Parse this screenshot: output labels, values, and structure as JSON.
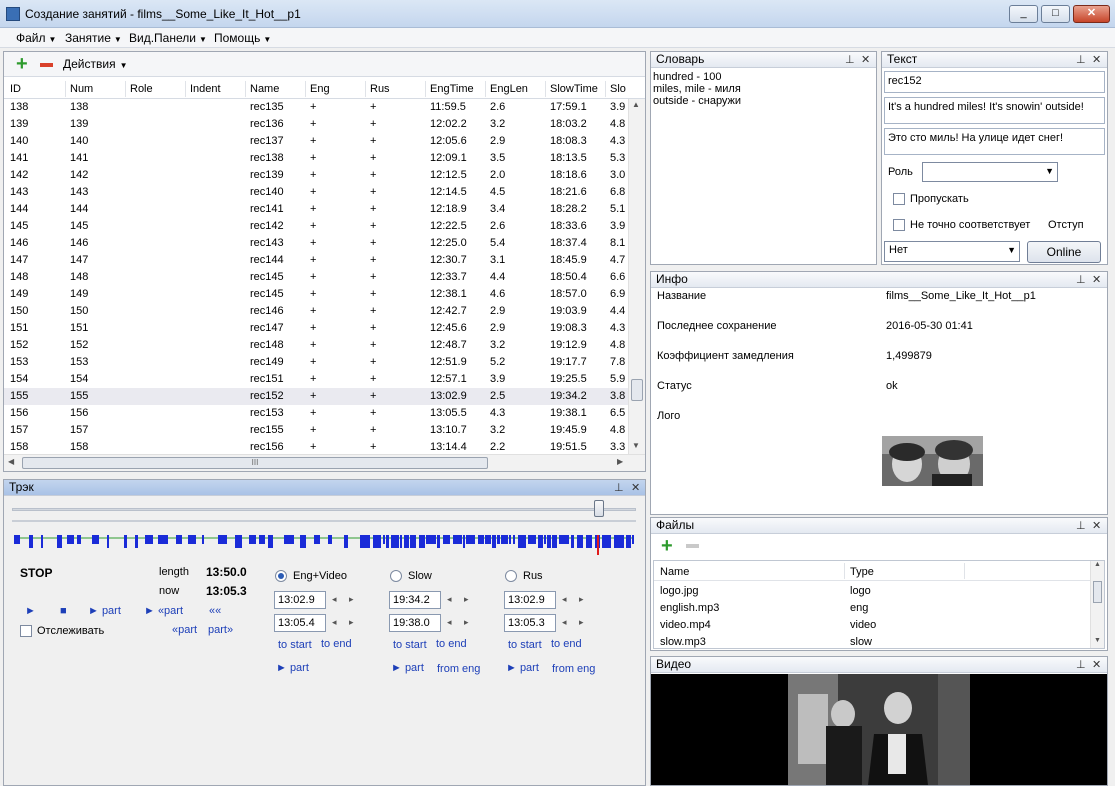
{
  "window": {
    "title": "Создание занятий - films__Some_Like_It_Hot__p1",
    "min": "_",
    "max": "□",
    "close": "✕"
  },
  "menu": [
    "Файл",
    "Занятие",
    "Вид.Панели",
    "Помощь"
  ],
  "grid": {
    "toolbar": {
      "add": "+",
      "actions_label": "Действия"
    },
    "columns": [
      "ID",
      "Num",
      "Role",
      "Indent",
      "Name",
      "Eng",
      "Rus",
      "EngTime",
      "EngLen",
      "SlowTime",
      "Slo"
    ],
    "rows": [
      [
        "138",
        "138",
        "",
        "",
        "rec135",
        "+",
        "+",
        "11:59.5",
        "2.6",
        "17:59.1",
        "3.9"
      ],
      [
        "139",
        "139",
        "",
        "",
        "rec136",
        "+",
        "+",
        "12:02.2",
        "3.2",
        "18:03.2",
        "4.8"
      ],
      [
        "140",
        "140",
        "",
        "",
        "rec137",
        "+",
        "+",
        "12:05.6",
        "2.9",
        "18:08.3",
        "4.3"
      ],
      [
        "141",
        "141",
        "",
        "",
        "rec138",
        "+",
        "+",
        "12:09.1",
        "3.5",
        "18:13.5",
        "5.3"
      ],
      [
        "142",
        "142",
        "",
        "",
        "rec139",
        "+",
        "+",
        "12:12.5",
        "2.0",
        "18:18.6",
        "3.0"
      ],
      [
        "143",
        "143",
        "",
        "",
        "rec140",
        "+",
        "+",
        "12:14.5",
        "4.5",
        "18:21.6",
        "6.8"
      ],
      [
        "144",
        "144",
        "",
        "",
        "rec141",
        "+",
        "+",
        "12:18.9",
        "3.4",
        "18:28.2",
        "5.1"
      ],
      [
        "145",
        "145",
        "",
        "",
        "rec142",
        "+",
        "+",
        "12:22.5",
        "2.6",
        "18:33.6",
        "3.9"
      ],
      [
        "146",
        "146",
        "",
        "",
        "rec143",
        "+",
        "+",
        "12:25.0",
        "5.4",
        "18:37.4",
        "8.1"
      ],
      [
        "147",
        "147",
        "",
        "",
        "rec144",
        "+",
        "+",
        "12:30.7",
        "3.1",
        "18:45.9",
        "4.7"
      ],
      [
        "148",
        "148",
        "",
        "",
        "rec145",
        "+",
        "+",
        "12:33.7",
        "4.4",
        "18:50.4",
        "6.6"
      ],
      [
        "149",
        "149",
        "",
        "",
        "rec145",
        "+",
        "+",
        "12:38.1",
        "4.6",
        "18:57.0",
        "6.9"
      ],
      [
        "150",
        "150",
        "",
        "",
        "rec146",
        "+",
        "+",
        "12:42.7",
        "2.9",
        "19:03.9",
        "4.4"
      ],
      [
        "151",
        "151",
        "",
        "",
        "rec147",
        "+",
        "+",
        "12:45.6",
        "2.9",
        "19:08.3",
        "4.3"
      ],
      [
        "152",
        "152",
        "",
        "",
        "rec148",
        "+",
        "+",
        "12:48.7",
        "3.2",
        "19:12.9",
        "4.8"
      ],
      [
        "153",
        "153",
        "",
        "",
        "rec149",
        "+",
        "+",
        "12:51.9",
        "5.2",
        "19:17.7",
        "7.8"
      ],
      [
        "154",
        "154",
        "",
        "",
        "rec151",
        "+",
        "+",
        "12:57.1",
        "3.9",
        "19:25.5",
        "5.9"
      ],
      [
        "155",
        "155",
        "",
        "",
        "rec152",
        "+",
        "+",
        "13:02.9",
        "2.5",
        "19:34.2",
        "3.8"
      ],
      [
        "156",
        "156",
        "",
        "",
        "rec153",
        "+",
        "+",
        "13:05.5",
        "4.3",
        "19:38.1",
        "6.5"
      ],
      [
        "157",
        "157",
        "",
        "",
        "rec155",
        "+",
        "+",
        "13:10.7",
        "3.2",
        "19:45.9",
        "4.8"
      ],
      [
        "158",
        "158",
        "",
        "",
        "rec156",
        "+",
        "+",
        "13:14.4",
        "2.2",
        "19:51.5",
        "3.3"
      ]
    ],
    "selected_row": 17,
    "hscroll_grip": "III"
  },
  "track": {
    "title": "Трэк",
    "stop": "STOP",
    "length_label": "length",
    "length_value": "13:50.0",
    "now_label": "now",
    "now_value": "13:05.3",
    "controls": [
      "►",
      "■",
      "► part",
      "► «part",
      "««"
    ],
    "follow_label": "Отслеживать",
    "part_back": "«part",
    "part_fwd": "part»",
    "modes": [
      {
        "label": "Eng+Video",
        "checked": true,
        "start": "13:02.9",
        "end": "13:05.4",
        "to_start": "to start",
        "to_end": "to end",
        "play": "► part",
        "extra": ""
      },
      {
        "label": "Slow",
        "checked": false,
        "start": "19:34.2",
        "end": "19:38.0",
        "to_start": "to start",
        "to_end": "to end",
        "play": "► part",
        "extra": "from eng"
      },
      {
        "label": "Rus",
        "checked": false,
        "start": "13:02.9",
        "end": "13:05.3",
        "to_start": "to start",
        "to_end": "to end",
        "play": "► part",
        "extra": "from eng"
      }
    ],
    "slider_value": 0.94
  },
  "dictionary": {
    "title": "Словарь",
    "entries": [
      "hundred - 100",
      "miles, mile - миля",
      "outside - снаружи"
    ]
  },
  "text": {
    "title": "Текст",
    "name": "rec152",
    "eng": "It's a hundred miles! It's snowin' outside!",
    "rus": "Это сто миль! На улице идет снег!",
    "role_label": "Роль",
    "role_value": "",
    "skip_label": "Пропускать",
    "inexact_label": "Не точно соответствует",
    "indent_label": "Отступ",
    "indent_value": "Нет",
    "online_button": "Online"
  },
  "info": {
    "title": "Инфо",
    "rows": [
      {
        "label": "Название",
        "value": "films__Some_Like_It_Hot__p1"
      },
      {
        "label": "Последнее сохранение",
        "value": "2016-05-30 01:41"
      },
      {
        "label": "Коэффициент замедления",
        "value": "1,499879"
      },
      {
        "label": "Статус",
        "value": "ok"
      },
      {
        "label": "Лого",
        "value": ""
      }
    ]
  },
  "files": {
    "title": "Файлы",
    "columns": [
      "Name",
      "Type"
    ],
    "rows": [
      [
        "logo.jpg",
        "logo"
      ],
      [
        "english.mp3",
        "eng"
      ],
      [
        "video.mp4",
        "video"
      ],
      [
        "slow.mp3",
        "slow"
      ]
    ]
  },
  "video": {
    "title": "Видео"
  },
  "icons": {
    "pin": "pin-icon",
    "close": "close-icon",
    "pin_glyph": "⊥",
    "close_glyph": "✕",
    "dd_glyph": "▼",
    "left_glyph": "◂",
    "right_glyph": "▸"
  },
  "colors": {
    "accent_blue": "#1a2bd8",
    "marker_red": "#e01b1b",
    "panel_head_active": "#a9c2e6"
  }
}
